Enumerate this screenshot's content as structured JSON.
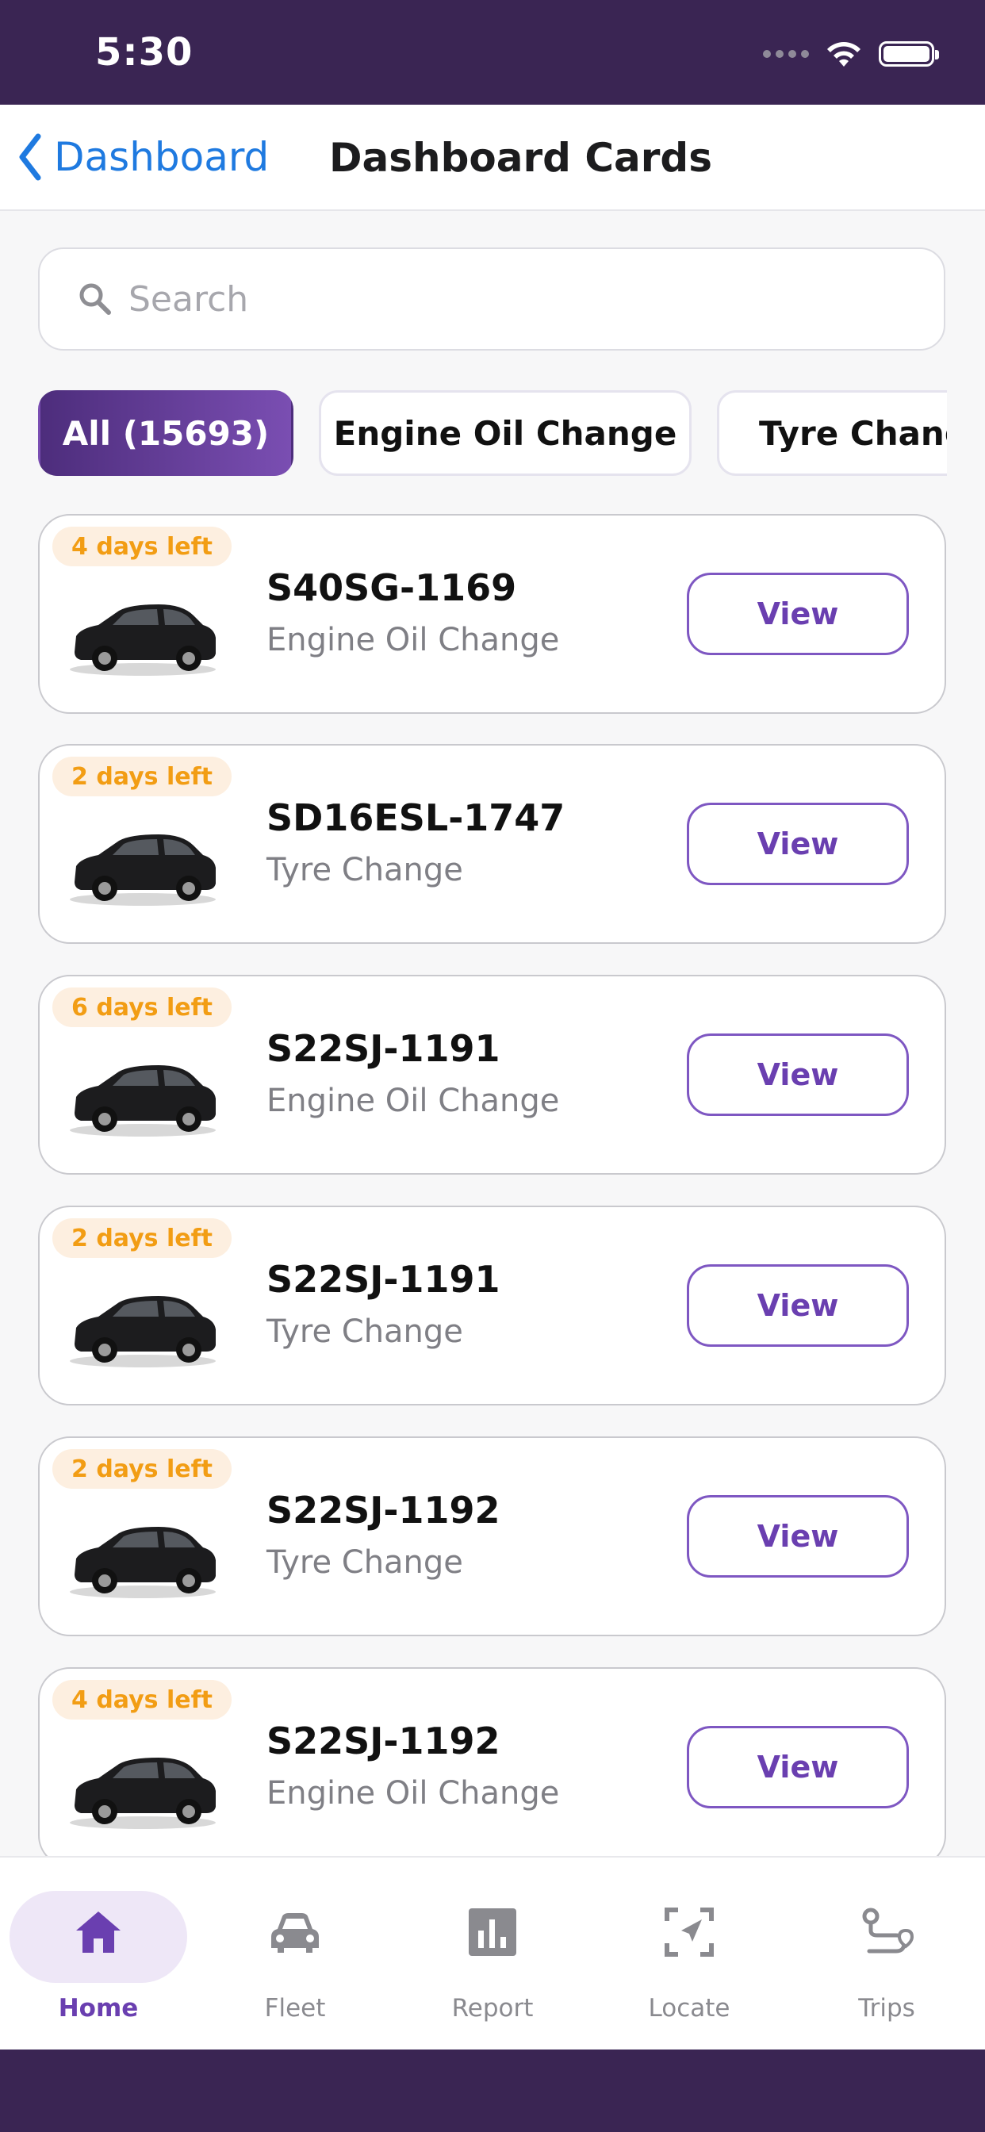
{
  "status_bar": {
    "time": "5:30"
  },
  "nav": {
    "back_label": "Dashboard",
    "title": "Dashboard Cards"
  },
  "search": {
    "placeholder": "Search",
    "value": ""
  },
  "filters": [
    {
      "label": "All (15693)",
      "active": true
    },
    {
      "label": "Engine Oil Change",
      "active": false
    },
    {
      "label": "Tyre Change",
      "active": false
    }
  ],
  "cards": [
    {
      "badge": "4 days left",
      "plate": "S40SG-1169",
      "service": "Engine Oil Change",
      "action": "View"
    },
    {
      "badge": "2 days left",
      "plate": "SD16ESL-1747",
      "service": "Tyre Change",
      "action": "View"
    },
    {
      "badge": "6 days left",
      "plate": "S22SJ-1191",
      "service": "Engine Oil Change",
      "action": "View"
    },
    {
      "badge": "2 days left",
      "plate": "S22SJ-1191",
      "service": "Tyre Change",
      "action": "View"
    },
    {
      "badge": "2 days left",
      "plate": "S22SJ-1192",
      "service": "Tyre Change",
      "action": "View"
    },
    {
      "badge": "4 days left",
      "plate": "S22SJ-1192",
      "service": "Engine Oil Change",
      "action": "View"
    }
  ],
  "tabs": [
    {
      "label": "Home",
      "icon": "home-icon",
      "active": true
    },
    {
      "label": "Fleet",
      "icon": "car-icon",
      "active": false
    },
    {
      "label": "Report",
      "icon": "bar-chart-icon",
      "active": false
    },
    {
      "label": "Locate",
      "icon": "locate-icon",
      "active": false
    },
    {
      "label": "Trips",
      "icon": "route-icon",
      "active": false
    }
  ],
  "colors": {
    "status_bar": "#3a2553",
    "accent": "#6a3fb0",
    "badge_text": "#f29d14",
    "badge_bg": "#fdefe0",
    "link": "#1f7ae0"
  }
}
